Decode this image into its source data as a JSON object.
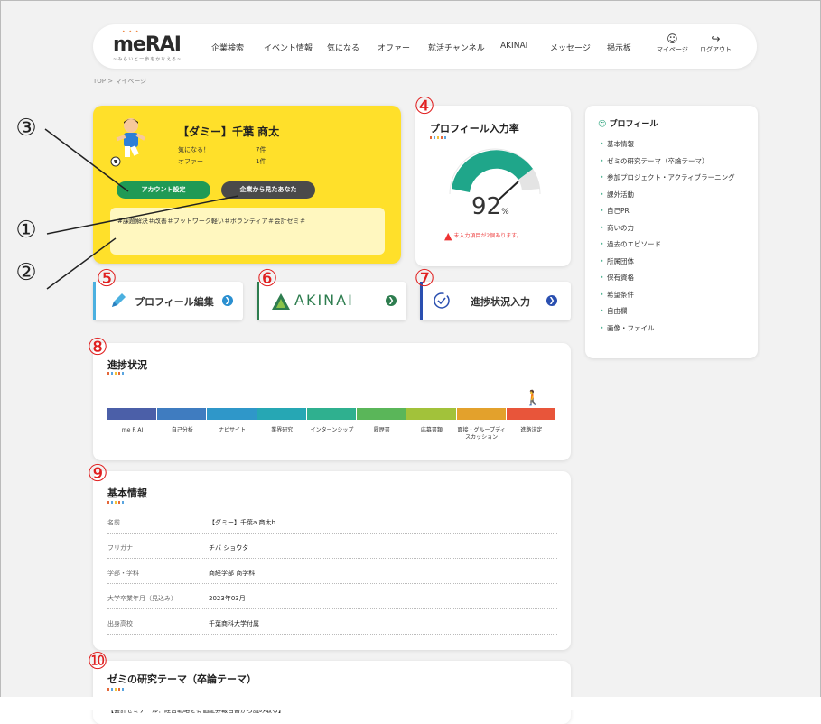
{
  "header": {
    "logo": "meRAI",
    "logo_sub": "~みらいと一歩をかなえる~",
    "nav": [
      "企業検索",
      "イベント情報",
      "気になる",
      "オファー",
      "就活チャンネル",
      "AKINAI",
      "メッセージ",
      "掲示板"
    ],
    "mypage_label": "マイページ",
    "logout_label": "ログアウト"
  },
  "breadcrumb": "TOP > マイページ",
  "profile": {
    "name": "【ダミー】千葉 商太",
    "stats": [
      {
        "label": "気になる！",
        "value": "7件"
      },
      {
        "label": "オファー",
        "value": "1件"
      }
    ],
    "account_button": "アカウント設定",
    "company_view_button": "企業から見たあなた",
    "tags": "#課題解決＃改善＃フットワーク軽い＃ボランティア＃会計ゼミ＃"
  },
  "profile_rate": {
    "title": "プロフィール入力率",
    "value": "92",
    "unit": "%",
    "warning": "未入力項目が2個あります。"
  },
  "links": [
    {
      "label": "プロフィール編集"
    },
    {
      "label": "AKINAI"
    },
    {
      "label": "進捗状況入力"
    }
  ],
  "progress": {
    "title": "進捗状況",
    "stages": [
      "me R AI",
      "自己分析",
      "ナビサイト",
      "業界研究",
      "インターンシップ",
      "履歴書",
      "応募書類",
      "面接・グループディスカッション",
      "進路決定"
    ],
    "current_stage_index": 8
  },
  "basic_info": {
    "title": "基本情報",
    "rows": [
      {
        "key": "名前",
        "value": "【ダミー】千葉a 商太b"
      },
      {
        "key": "フリガナ",
        "value": "チバ ショウタ"
      },
      {
        "key": "学部・学科",
        "value": "商経学部 商学科"
      },
      {
        "key": "大学卒業年月（見込み）",
        "value": "2023年03月"
      },
      {
        "key": "出身高校",
        "value": "千葉商科大学付属"
      }
    ]
  },
  "seminar": {
    "title": "ゼミの研究テーマ（卒論テーマ）",
    "content": "【会計ゼミナール：経営戦略を有価証券報告書から読み取る】"
  },
  "sidebar": {
    "title": "プロフィール",
    "items": [
      "基本情報",
      "ゼミの研究テーマ（卒論テーマ）",
      "参加プロジェクト・アクティブラーニング",
      "課外活動",
      "自己PR",
      "商いの力",
      "過去のエピソード",
      "所属団体",
      "保有資格",
      "希望条件",
      "自由欄",
      "画像・ファイル"
    ]
  },
  "annotations": [
    "①",
    "②",
    "③",
    "④",
    "⑤",
    "⑥",
    "⑦",
    "⑧",
    "⑨",
    "⑩"
  ],
  "colors": {
    "profile_bg": "#ffe02a",
    "accent_green": "#27a27a",
    "gauge_green": "#1fa68a",
    "warning_red": "#e02020"
  }
}
